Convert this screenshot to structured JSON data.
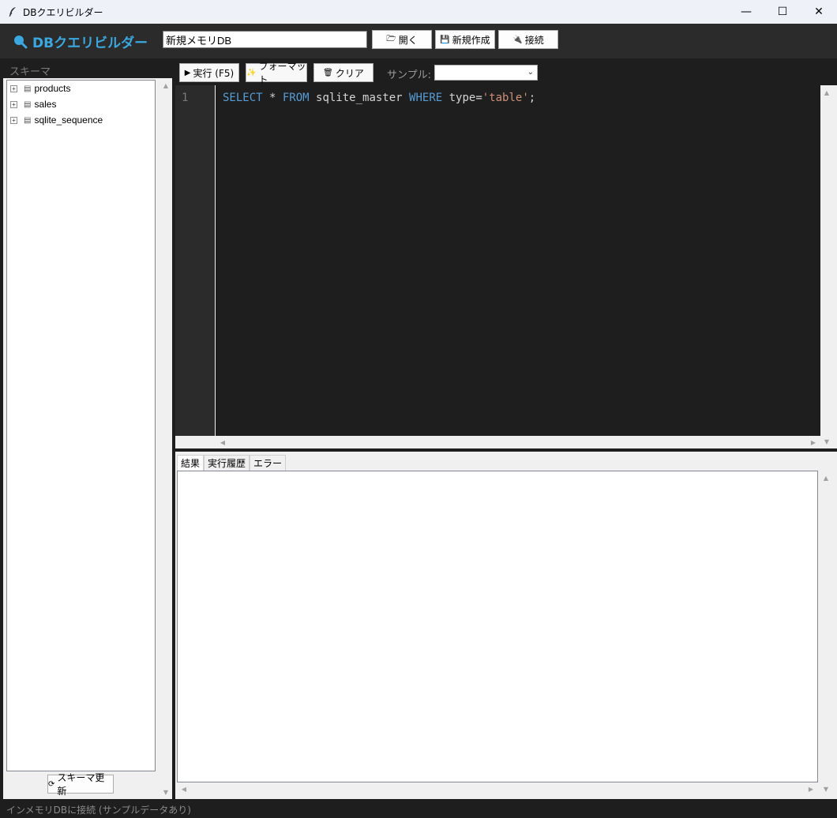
{
  "window": {
    "title": "DBクエリビルダー",
    "minimize": "—",
    "maximize": "☐",
    "close": "✕"
  },
  "toolbar": {
    "brand": "DBクエリビルダー",
    "db_name_value": "新規メモリDB",
    "open_label": "開く",
    "new_label": "新規作成",
    "connect_label": "接続"
  },
  "schema": {
    "label": "スキーマ",
    "tables": [
      {
        "name": "products"
      },
      {
        "name": "sales"
      },
      {
        "name": "sqlite_sequence"
      }
    ],
    "refresh_label": "スキーマ更新"
  },
  "editor_toolbar": {
    "run_label": "実行 (F5)",
    "format_label": "フォーマット",
    "clear_label": "クリア",
    "sample_label": "サンプル:",
    "sample_value": ""
  },
  "editor": {
    "line_number": "1",
    "tokens": {
      "select": "SELECT",
      "star": " * ",
      "from": "FROM",
      "table": " sqlite_master ",
      "where": "WHERE",
      "cond": " type=",
      "literal": "'table'",
      "end": ";"
    }
  },
  "results": {
    "tabs": [
      {
        "label": "結果"
      },
      {
        "label": "実行履歴"
      },
      {
        "label": "エラー"
      }
    ]
  },
  "status": {
    "text": "インメモリDBに接続 (サンプルデータあり)"
  },
  "colors": {
    "brand": "#3ba8e0",
    "keyword": "#569cd6",
    "string": "#ce9178",
    "editor_bg": "#1e1e1e"
  }
}
